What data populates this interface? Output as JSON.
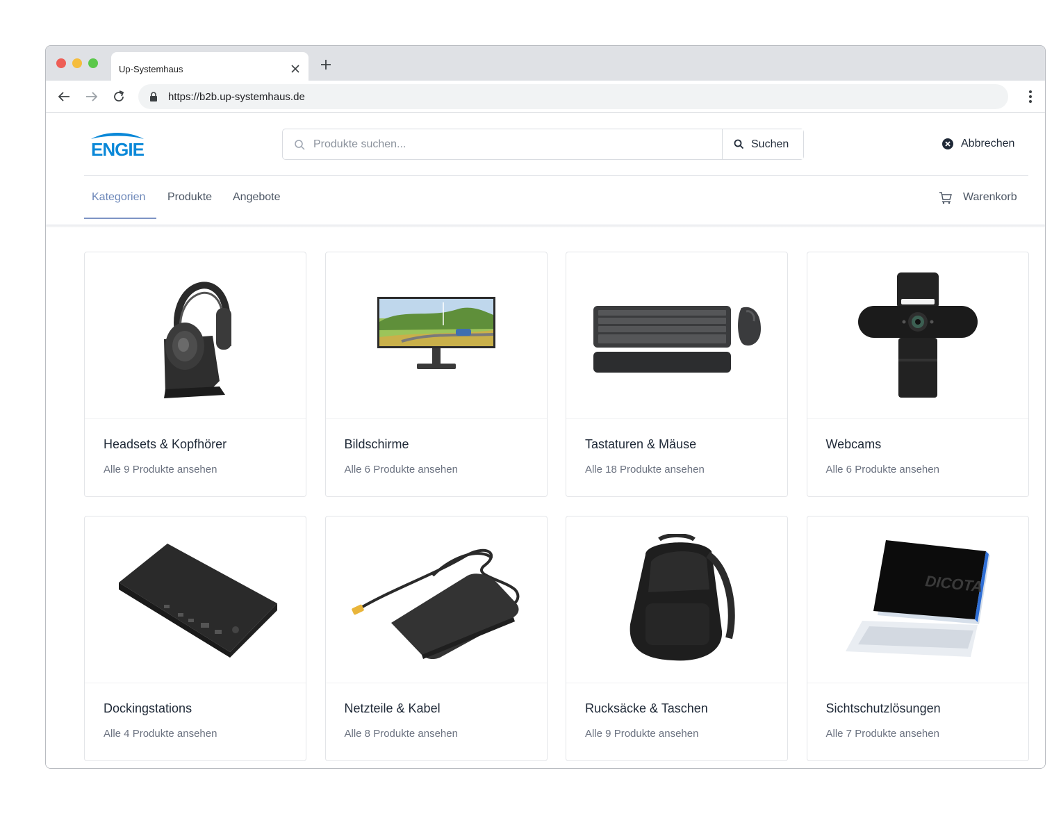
{
  "browser": {
    "tab_title": "Up-Systemhaus",
    "url": "https://b2b.up-systemhaus.de"
  },
  "header": {
    "logo_text": "ENGIE",
    "search_placeholder": "Produkte suchen...",
    "search_button": "Suchen",
    "cancel_label": "Abbrechen"
  },
  "nav": {
    "tabs": [
      {
        "label": "Kategorien",
        "active": true
      },
      {
        "label": "Produkte",
        "active": false
      },
      {
        "label": "Angebote",
        "active": false
      }
    ],
    "cart_label": "Warenkorb"
  },
  "categories": [
    {
      "title": "Headsets & Kopfhörer",
      "subtitle": "Alle 9 Produkte ansehen",
      "icon": "headset-icon"
    },
    {
      "title": "Bildschirme",
      "subtitle": "Alle 6 Produkte ansehen",
      "icon": "monitor-icon"
    },
    {
      "title": "Tastaturen & Mäuse",
      "subtitle": "Alle 18 Produkte ansehen",
      "icon": "keyboard-mouse-icon"
    },
    {
      "title": "Webcams",
      "subtitle": "Alle 6 Produkte ansehen",
      "icon": "webcam-icon"
    },
    {
      "title": "Dockingstations",
      "subtitle": "Alle 4 Produkte ansehen",
      "icon": "docking-station-icon"
    },
    {
      "title": "Netzteile & Kabel",
      "subtitle": "Alle 8 Produkte ansehen",
      "icon": "power-adapter-icon"
    },
    {
      "title": "Rucksäcke & Taschen",
      "subtitle": "Alle 9 Produkte ansehen",
      "icon": "backpack-icon"
    },
    {
      "title": "Sichtschutzlösungen",
      "subtitle": "Alle 7 Produkte ansehen",
      "icon": "privacy-filter-icon"
    }
  ],
  "colors": {
    "accent": "#7d94c4",
    "logo_blue": "#0a88d8"
  }
}
